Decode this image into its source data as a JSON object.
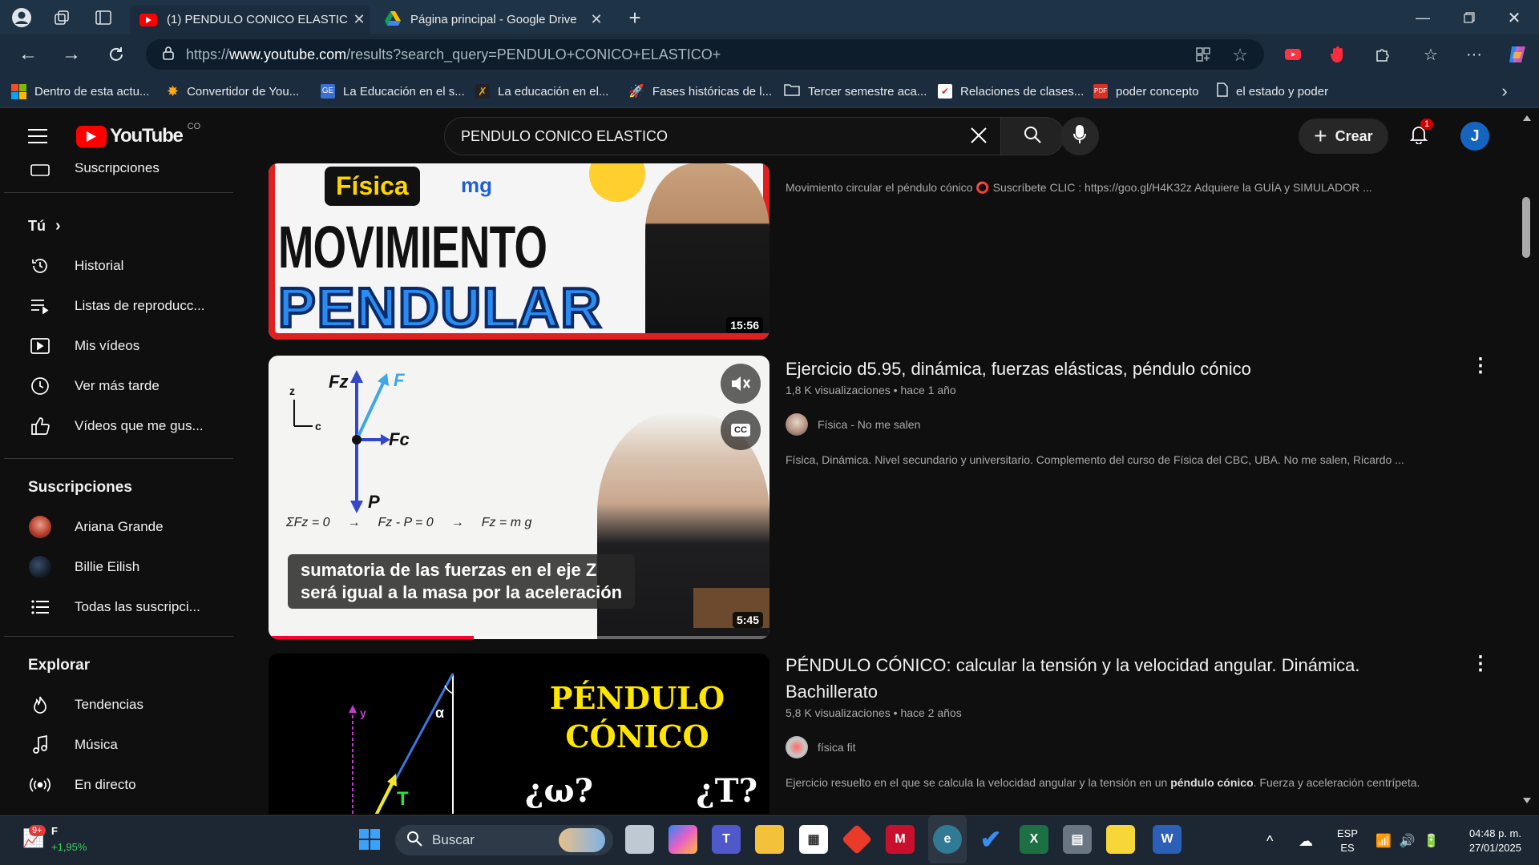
{
  "browser": {
    "tabs": [
      {
        "title": "(1) PENDULO CONICO ELASTICO",
        "active": true
      },
      {
        "title": "Página principal - Google Drive",
        "active": false
      }
    ],
    "url_prefix": "https://",
    "url_host": "www.youtube.com",
    "url_path": "/results?search_query=PENDULO+CONICO+ELASTICO+",
    "bookmarks": [
      {
        "label": "Dentro de esta actu...",
        "color": "#f25022"
      },
      {
        "label": "Convertidor de You...",
        "color": "#f7a81b"
      },
      {
        "label": "La Educación en el s...",
        "color": "#3b6fd6"
      },
      {
        "label": "La educación en el...",
        "color": "#e5a02a"
      },
      {
        "label": "Fases históricas de l...",
        "color": "#dfe3e8"
      },
      {
        "label": "Tercer semestre aca...",
        "color": "#dfe3e8"
      },
      {
        "label": "Relaciones de clases...",
        "color": "#dfe3e8"
      },
      {
        "label": "poder concepto",
        "color": "#d93025"
      },
      {
        "label": "el estado y poder",
        "color": "#dfe3e8"
      }
    ]
  },
  "youtube": {
    "logo_text": "YouTube",
    "country": "CO",
    "search_value": "PENDULO CONICO ELASTICO",
    "create_label": "Crear",
    "notif_count": "1",
    "avatar_letter": "J",
    "accent": "#ff0000"
  },
  "sidebar": {
    "top_partial": "Suscripciones",
    "you_header": "Tú",
    "you_items": [
      {
        "label": "Historial",
        "icon": "history-icon"
      },
      {
        "label": "Listas de reproducc...",
        "icon": "playlist-icon"
      },
      {
        "label": "Mis vídeos",
        "icon": "my-videos-icon"
      },
      {
        "label": "Ver más tarde",
        "icon": "watch-later-icon"
      },
      {
        "label": "Vídeos que me gus...",
        "icon": "like-icon"
      }
    ],
    "subs_header": "Suscripciones",
    "subs_items": [
      {
        "label": "Ariana Grande"
      },
      {
        "label": "Billie Eilish"
      },
      {
        "label": "Todas las suscripci..."
      }
    ],
    "explore_header": "Explorar",
    "explore_items": [
      {
        "label": "Tendencias",
        "icon": "trending-icon"
      },
      {
        "label": "Música",
        "icon": "music-icon"
      },
      {
        "label": "En directo",
        "icon": "live-icon"
      }
    ]
  },
  "videos": [
    {
      "thumb_tag": "Física",
      "thumb_line1": "MOVIMIENTO",
      "thumb_line2": "PENDULAR",
      "thumb_mg": "mg",
      "duration": "15:56",
      "description": "Movimiento circular el péndulo cónico ⭕ Suscríbete CLIC : https://goo.gl/H4K32z Adquiere la GUÍA y SIMULADOR ..."
    },
    {
      "title": "Ejercicio d5.95, dinámica, fuerzas elásticas, péndulo cónico",
      "views": "1,8 K visualizaciones",
      "age": "hace 1 año",
      "channel": "Física - No me salen",
      "description": "Física, Dinámica. Nivel secundario y universitario. Complemento del curso de Física del CBC, UBA. No me salen, Ricardo ...",
      "duration": "5:45",
      "caption_line1": "sumatoria de las fuerzas en el eje Z",
      "caption_line2": "será igual a la masa por la aceleración",
      "eq1": "ΣFz = 0",
      "eq2": "Fz - P = 0",
      "eq3": "Fz = m g",
      "arrow": "→",
      "lbl_fz": "Fz",
      "lbl_f": "F",
      "lbl_fc": "Fc",
      "lbl_p": "P",
      "lbl_z": "z",
      "lbl_c": "c",
      "cc": "CC",
      "progress": 0.41
    },
    {
      "title": "PÉNDULO CÓNICO: calcular la tensión y la velocidad angular. Dinámica. Bachillerato",
      "views": "5,8 K visualizaciones",
      "age": "hace 2 años",
      "channel": "física fit",
      "description_a": "Ejercicio resuelto en el que se calcula la velocidad angular y la tensión en un ",
      "description_b": "péndulo cónico",
      "description_c": ". Fuerza y aceleración centrípeta.",
      "thumb_l1": "PÉNDULO",
      "thumb_l2": "CÓNICO",
      "thumb_q1": "¿ω?",
      "thumb_q2": "¿T?",
      "lbl_alpha": "α",
      "lbl_y": "y",
      "lbl_t": "T"
    }
  ],
  "taskbar": {
    "weather_badge": "9+",
    "weather_letter": "F",
    "weather_change": "+1,95%",
    "search_placeholder": "Buscar",
    "lang1": "ESP",
    "lang2": "ES",
    "time": "04:48 p. m.",
    "date": "27/01/2025"
  }
}
